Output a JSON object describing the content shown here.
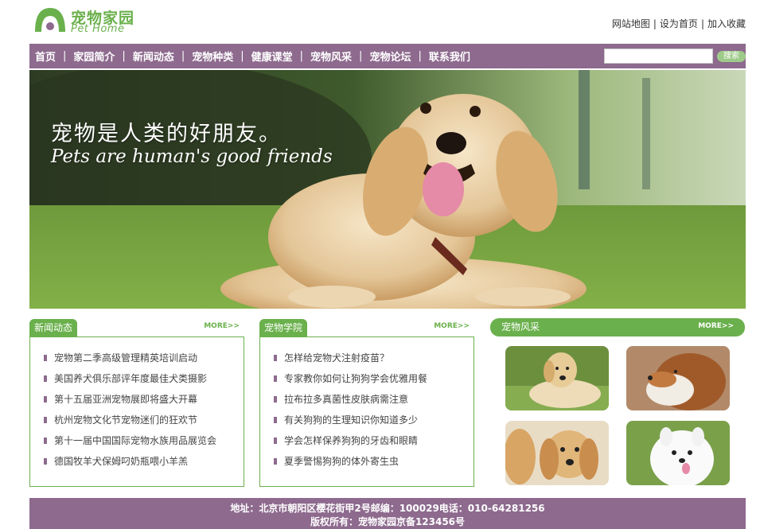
{
  "header": {
    "logo_cn": "宠物家园",
    "logo_en": "Pet Home",
    "top_links": [
      "网站地图",
      "设为首页",
      "加入收藏"
    ]
  },
  "nav": {
    "items": [
      "首页",
      "家园简介",
      "新闻动态",
      "宠物种类",
      "健康课堂",
      "宠物风采",
      "宠物论坛",
      "联系我们"
    ],
    "search_value": "",
    "search_button": "搜索"
  },
  "banner": {
    "title_cn": "宠物是人类的好朋友。",
    "title_en": "Pets are human's good friends"
  },
  "news": {
    "title": "新闻动态",
    "more": "MORE>>",
    "items": [
      "宠物第二季高级管理精英培训启动",
      "美国养犬俱乐部评年度最佳犬类摄影",
      "第十五届亚洲宠物展即将盛大开幕",
      "杭州宠物文化节宠物迷们的狂欢节",
      "第十一届中国国际宠物水族用品展览会",
      "德国牧羊犬保姆叼奶瓶喂小羊羔"
    ]
  },
  "academy": {
    "title": "宠物学院",
    "more": "MORE>>",
    "items": [
      "怎样给宠物犬注射疫苗？",
      "专家教你如何让狗狗学会优雅用餐",
      "拉布拉多真菌性皮肤病需注意",
      "有关狗狗的生理知识你知道多少",
      "学会怎样保养狗狗的牙齿和眼睛",
      "夏季警惕狗狗的体外寄生虫"
    ]
  },
  "gallery": {
    "title": "宠物风采",
    "more": "MORE>>"
  },
  "footer": {
    "line1": "地址：北京市朝阳区樱花街甲2号邮编：100029电话：010-64281256",
    "line2": "版权所有：宠物家园京备123456号"
  },
  "colors": {
    "brand_green": "#6ab04c",
    "brand_purple": "#8d6a8e"
  }
}
